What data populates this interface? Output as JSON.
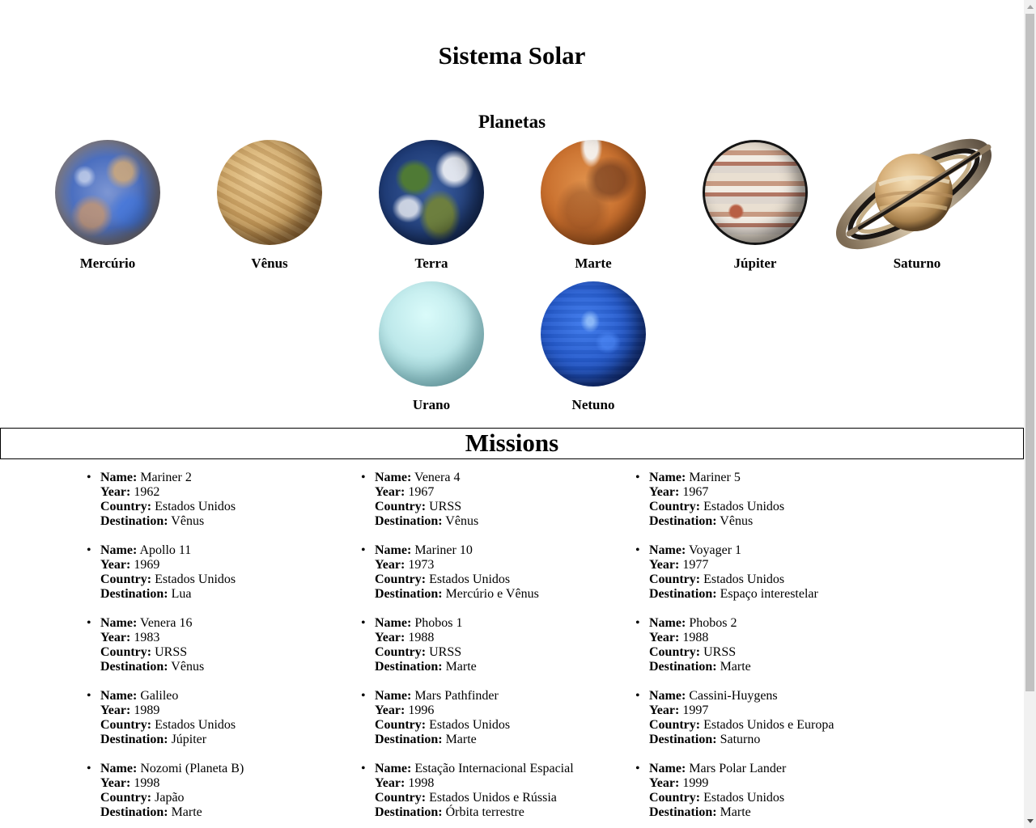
{
  "page": {
    "title": "Sistema Solar",
    "planets_heading": "Planetas",
    "missions_heading": "Missions"
  },
  "labels": {
    "name": "Name:",
    "year": "Year:",
    "country": "Country:",
    "destination": "Destination:"
  },
  "planets": [
    {
      "name": "Mercúrio",
      "icon": "mercury-image"
    },
    {
      "name": "Vênus",
      "icon": "venus-image"
    },
    {
      "name": "Terra",
      "icon": "earth-image"
    },
    {
      "name": "Marte",
      "icon": "mars-image"
    },
    {
      "name": "Júpiter",
      "icon": "jupiter-image"
    },
    {
      "name": "Saturno",
      "icon": "saturn-image"
    },
    {
      "name": "Urano",
      "icon": "uranus-image"
    },
    {
      "name": "Netuno",
      "icon": "neptune-image"
    }
  ],
  "missions": [
    {
      "name": "Mariner 2",
      "year": "1962",
      "country": "Estados Unidos",
      "destination": "Vênus"
    },
    {
      "name": "Venera 4",
      "year": "1967",
      "country": "URSS",
      "destination": "Vênus"
    },
    {
      "name": "Mariner 5",
      "year": "1967",
      "country": "Estados Unidos",
      "destination": "Vênus"
    },
    {
      "name": "Apollo 11",
      "year": "1969",
      "country": "Estados Unidos",
      "destination": "Lua"
    },
    {
      "name": "Mariner 10",
      "year": "1973",
      "country": "Estados Unidos",
      "destination": "Mercúrio e Vênus"
    },
    {
      "name": "Voyager 1",
      "year": "1977",
      "country": "Estados Unidos",
      "destination": "Espaço interestelar"
    },
    {
      "name": "Venera 16",
      "year": "1983",
      "country": "URSS",
      "destination": "Vênus"
    },
    {
      "name": "Phobos 1",
      "year": "1988",
      "country": "URSS",
      "destination": "Marte"
    },
    {
      "name": "Phobos 2",
      "year": "1988",
      "country": "URSS",
      "destination": "Marte"
    },
    {
      "name": "Galileo",
      "year": "1989",
      "country": "Estados Unidos",
      "destination": "Júpiter"
    },
    {
      "name": "Mars Pathfinder",
      "year": "1996",
      "country": "Estados Unidos",
      "destination": "Marte"
    },
    {
      "name": "Cassini-Huygens",
      "year": "1997",
      "country": "Estados Unidos e Europa",
      "destination": "Saturno"
    },
    {
      "name": "Nozomi (Planeta B)",
      "year": "1998",
      "country": "Japão",
      "destination": "Marte"
    },
    {
      "name": "Estação Internacional Espacial",
      "year": "1998",
      "country": "Estados Unidos e Rússia",
      "destination": "Órbita terrestre"
    },
    {
      "name": "Mars Polar Lander",
      "year": "1999",
      "country": "Estados Unidos",
      "destination": "Marte"
    }
  ]
}
